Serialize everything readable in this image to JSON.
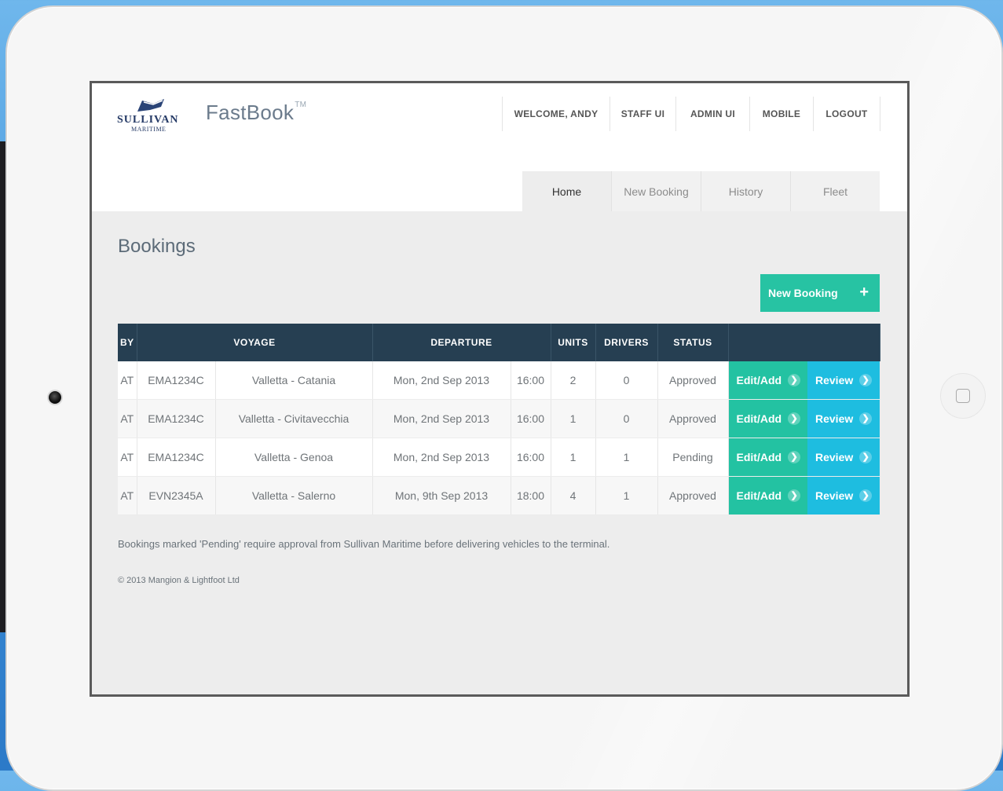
{
  "brand": {
    "logo_text": "SULLIVAN",
    "logo_sub": "MARITIME",
    "app_name": "FastBook",
    "tm": "TM"
  },
  "topnav": [
    "WELCOME, ANDY",
    "STAFF UI",
    "ADMIN UI",
    "MOBILE",
    "LOGOUT"
  ],
  "tabs": [
    "Home",
    "New Booking",
    "History",
    "Fleet"
  ],
  "active_tab": "Home",
  "page": {
    "title": "Bookings",
    "new_booking_label": "New Booking",
    "new_booking_icon": "plus-icon"
  },
  "table": {
    "headers": {
      "by": "BY",
      "voyage": "VOYAGE",
      "departure": "DEPARTURE",
      "units": "UNITS",
      "drivers": "DRIVERS",
      "status": "STATUS"
    },
    "rows": [
      {
        "by": "AT",
        "vessel": "EMA1234C",
        "route": "Valletta - Catania",
        "date": "Mon, 2nd Sep 2013",
        "time": "16:00",
        "units": "2",
        "drivers": "0",
        "status": "Approved",
        "edit_label": "Edit/Add",
        "review_label": "Review"
      },
      {
        "by": "AT",
        "vessel": "EMA1234C",
        "route": "Valletta - Civitavecchia",
        "date": "Mon, 2nd Sep 2013",
        "time": "16:00",
        "units": "1",
        "drivers": "0",
        "status": "Approved",
        "edit_label": "Edit/Add",
        "review_label": "Review"
      },
      {
        "by": "AT",
        "vessel": "EMA1234C",
        "route": "Valletta - Genoa",
        "date": "Mon, 2nd Sep 2013",
        "time": "16:00",
        "units": "1",
        "drivers": "1",
        "status": "Pending",
        "edit_label": "Edit/Add",
        "review_label": "Review"
      },
      {
        "by": "AT",
        "vessel": "EVN2345A",
        "route": "Valletta - Salerno",
        "date": "Mon, 9th Sep 2013",
        "time": "18:00",
        "units": "4",
        "drivers": "1",
        "status": "Approved",
        "edit_label": "Edit/Add",
        "review_label": "Review"
      }
    ]
  },
  "footer": {
    "note": "Bookings marked 'Pending' require approval from Sullivan Maritime before delivering vehicles to the terminal.",
    "copyright": "© 2013 Mangion & Lightfoot Ltd"
  },
  "colors": {
    "header_bg": "#263f52",
    "edit_btn": "#23c2a2",
    "review_btn": "#1ebde0",
    "new_btn": "#27c3a3",
    "frame_bg": "#3d8fd8"
  }
}
